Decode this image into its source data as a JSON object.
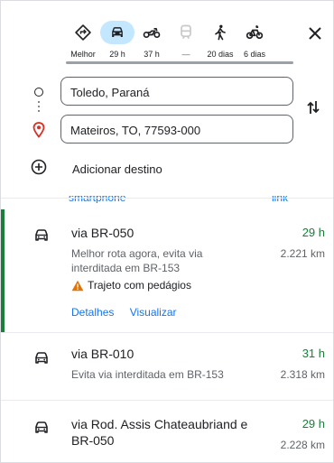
{
  "colors": {
    "accent": "#188038",
    "link": "#1a73e8",
    "active_mode": "#c2e7ff",
    "warning": "#e37400"
  },
  "modes": [
    {
      "icon": "diamond-turn-icon",
      "time": "Melhor"
    },
    {
      "icon": "car-icon",
      "time": "29 h"
    },
    {
      "icon": "motorcycle-icon",
      "time": "37 h"
    },
    {
      "icon": "train-icon",
      "time": "—"
    },
    {
      "icon": "walking-icon",
      "time": "20 dias"
    },
    {
      "icon": "bicycle-icon",
      "time": "6 dias"
    }
  ],
  "waypoints": {
    "origin": "Toledo, Paraná",
    "destination": "Mateiros, TO, 77593-000",
    "add_label": "Adicionar destino"
  },
  "clipped": {
    "left": "smartphone",
    "right": "link"
  },
  "routes": [
    {
      "title": "via BR-050",
      "time": "29 h",
      "distance": "2.221 km",
      "desc": "Melhor rota agora, evita via interditada em BR-153",
      "warning": "Trajeto com pedágios",
      "details": "Detalhes",
      "preview": "Visualizar"
    },
    {
      "title": "via BR-010",
      "time": "31 h",
      "distance": "2.318 km",
      "desc": "Evita via interditada em BR-153"
    },
    {
      "title": "via Rod. Assis Chateaubriand e BR-050",
      "time": "29 h",
      "distance": "2.228 km"
    }
  ]
}
